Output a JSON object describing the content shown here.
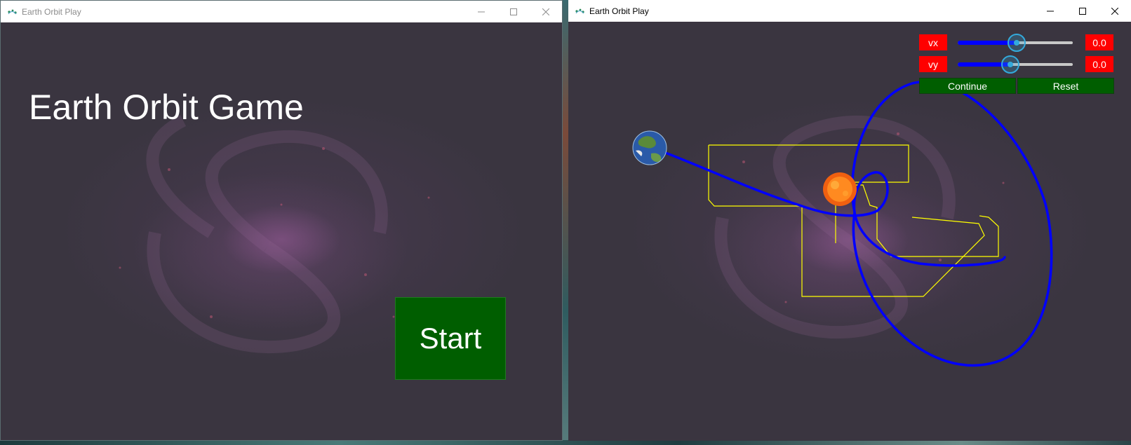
{
  "left_window": {
    "title": "Earth Orbit Play",
    "game_title": "Earth Orbit Game",
    "start_label": "Start",
    "icon": "app-icon"
  },
  "right_window": {
    "title": "Earth Orbit Play",
    "icon": "app-icon",
    "controls": {
      "vx": {
        "label": "vx",
        "value_text": "0.0",
        "slider_fraction": 0.51
      },
      "vy": {
        "label": "vy",
        "value_text": "0.0",
        "slider_fraction": 0.46
      },
      "continue_label": "Continue",
      "reset_label": "Reset"
    }
  },
  "colors": {
    "title_bar": "#ffffff",
    "label_red": "#ff0000",
    "button_green": "#005e00",
    "orbit_blue": "#0000ff",
    "maze_yellow": "#ffff00",
    "slider_accent": "#33aadc"
  }
}
